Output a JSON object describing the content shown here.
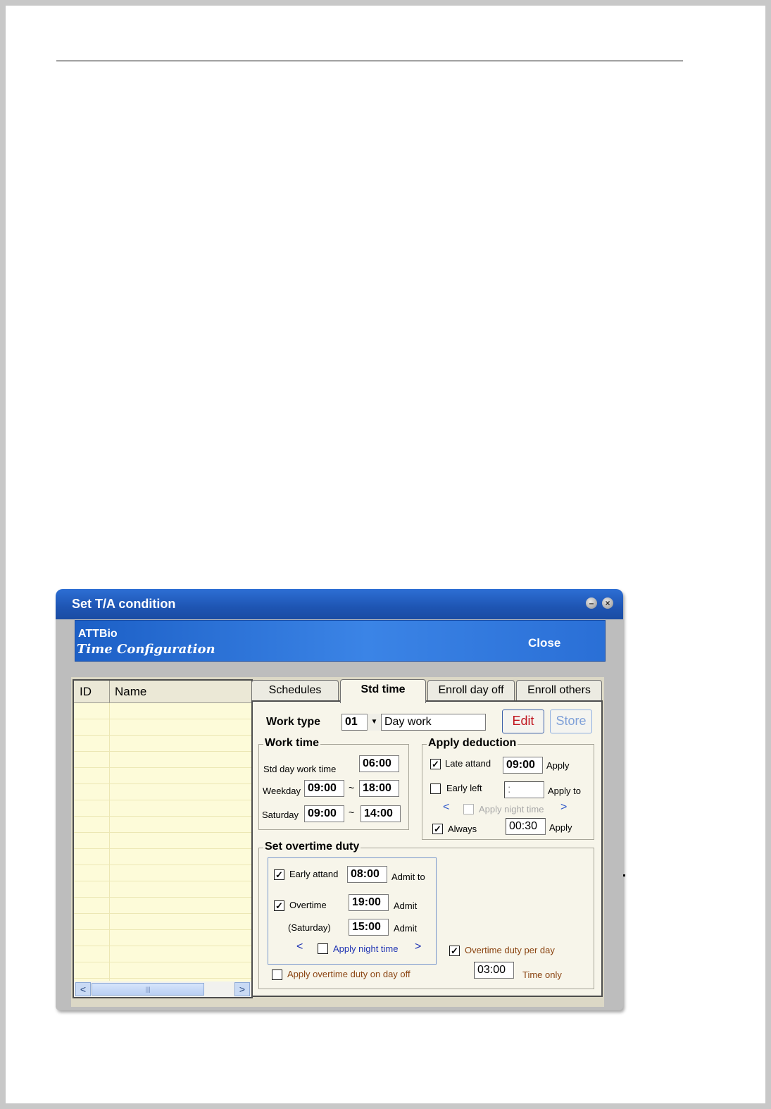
{
  "window": {
    "title": "Set T/A condition",
    "minimize_glyph": "–",
    "close_glyph": "×"
  },
  "banner": {
    "brand": "ATTBio",
    "subtitle": "Time Configuration",
    "close_label": "Close"
  },
  "list": {
    "columns": [
      "ID",
      "Name"
    ],
    "scroll_thumb_glyph": "|||",
    "scroll_left_glyph": "<",
    "scroll_right_glyph": ">"
  },
  "tabs": [
    {
      "label": "Schedules",
      "active": false
    },
    {
      "label": "Std time",
      "active": true
    },
    {
      "label": "Enroll day off",
      "active": false
    },
    {
      "label": "Enroll others",
      "active": false
    }
  ],
  "work_type": {
    "label": "Work type",
    "code": "01",
    "name": "Day work",
    "edit_label": "Edit",
    "store_label": "Store"
  },
  "work_time": {
    "title": "Work time",
    "std_day_label": "Std day work time",
    "std_day_value": "06:00",
    "weekday_label": "Weekday",
    "weekday_start": "09:00",
    "weekday_end": "18:00",
    "saturday_label": "Saturday",
    "saturday_start": "09:00",
    "saturday_end": "14:00",
    "range_sep": "~"
  },
  "apply_deduction": {
    "title": "Apply deduction",
    "late_attend_label": "Late attand",
    "late_attend_checked": true,
    "late_attend_value": "09:00",
    "late_attend_suffix": "Apply",
    "early_left_label": "Early left",
    "early_left_checked": false,
    "early_left_value": ":",
    "early_left_suffix": "Apply to",
    "night_time_label": "Apply night time",
    "always_label": "Always",
    "always_checked": true,
    "always_value": "00:30",
    "always_suffix": "Apply",
    "prev_glyph": "<",
    "next_glyph": ">"
  },
  "overtime": {
    "title": "Set overtime duty",
    "early_attend_label": "Early attand",
    "early_attend_checked": true,
    "early_attend_value": "08:00",
    "early_attend_suffix": "Admit to",
    "overtime_label": "Overtime",
    "overtime_checked": true,
    "overtime_value": "19:00",
    "overtime_suffix": "Admit",
    "saturday_label": "(Saturday)",
    "saturday_value": "15:00",
    "saturday_suffix": "Admit",
    "night_time_label": "Apply night time",
    "day_off_label": "Apply overtime duty on day off",
    "per_day_label": "Overtime duty per day",
    "per_day_checked": true,
    "per_day_value": "03:00",
    "per_day_suffix": "Time only",
    "prev_glyph": "<",
    "next_glyph": ">",
    "check_glyph": "✓"
  },
  "colors": {
    "titlebar": "#1e55b3",
    "banner": "#2a6fd6",
    "list_bg": "#fdfbd9",
    "edit_text": "#c0141e",
    "store_text": "#7fa0d8",
    "link_blue": "#1f33b3",
    "brown_label": "#8b4513"
  }
}
